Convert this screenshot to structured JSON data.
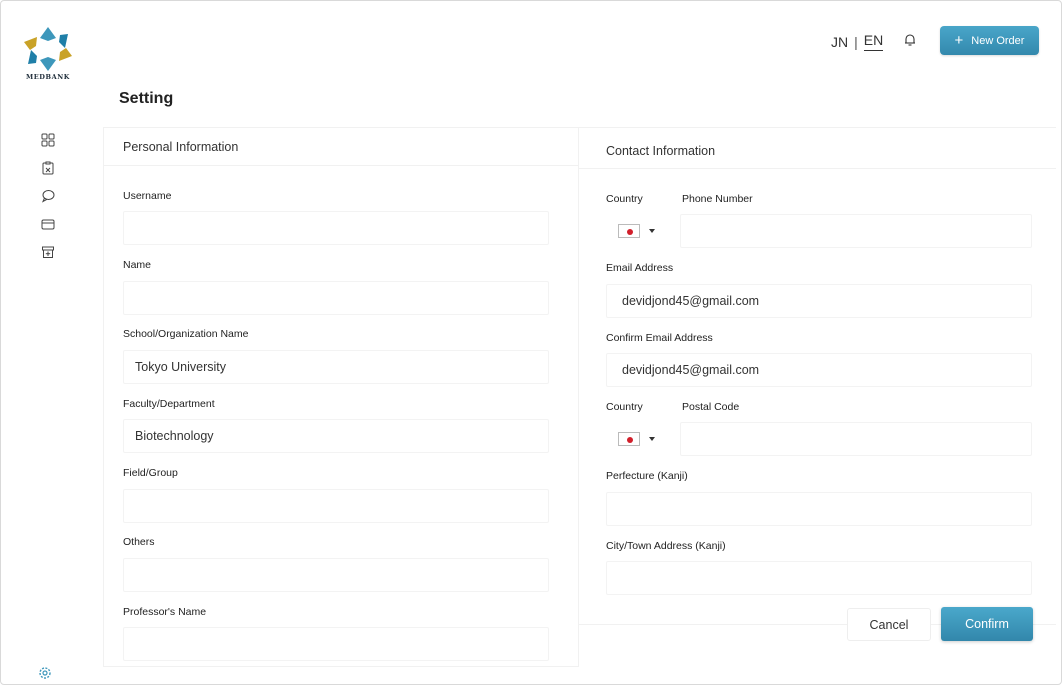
{
  "brand": {
    "logo_text": "MEDBANK"
  },
  "header": {
    "lang_options": [
      "JN",
      "EN"
    ],
    "lang_separator": "|",
    "active_lang": "EN",
    "new_order_label": "New Order",
    "new_order_icon": "plus-icon",
    "notification_icon": "bell-icon"
  },
  "sidebar": {
    "icons": [
      "dashboard-icon",
      "clipboard-icon",
      "chat-icon",
      "card-icon",
      "box-icon"
    ],
    "bottom_icon": "gear-icon"
  },
  "page": {
    "title": "Setting"
  },
  "personal": {
    "heading": "Personal Information",
    "fields": [
      {
        "label": "Username",
        "value": ""
      },
      {
        "label": "Name",
        "value": ""
      },
      {
        "label": "School/Organization Name",
        "value": "Tokyo University"
      },
      {
        "label": "Faculty/Department",
        "value": "Biotechnology"
      },
      {
        "label": "Field/Group",
        "value": ""
      },
      {
        "label": "Others",
        "value": ""
      },
      {
        "label": "Professor's Name",
        "value": ""
      }
    ]
  },
  "contact": {
    "heading": "Contact  Information",
    "phone_row": {
      "country_label": "Country",
      "label": "Phone Number",
      "value": ""
    },
    "email": {
      "label": "Email Address",
      "value": "devidjond45@gmail.com"
    },
    "confirm_email": {
      "label": "Confirm Email Address",
      "value": "devidjond45@gmail.com"
    },
    "postal_row": {
      "country_label": "Country",
      "label": "Postal Code",
      "value": ""
    },
    "prefecture": {
      "label": "Perfecture (Kanji)",
      "value": ""
    },
    "city": {
      "label": "City/Town Address (Kanji)",
      "value": ""
    },
    "flag": "japan-flag-icon"
  },
  "actions": {
    "cancel_label": "Cancel",
    "confirm_label": "Confirm"
  },
  "colors": {
    "accent": "#3d97bb",
    "flag_red": "#d21f2b"
  }
}
